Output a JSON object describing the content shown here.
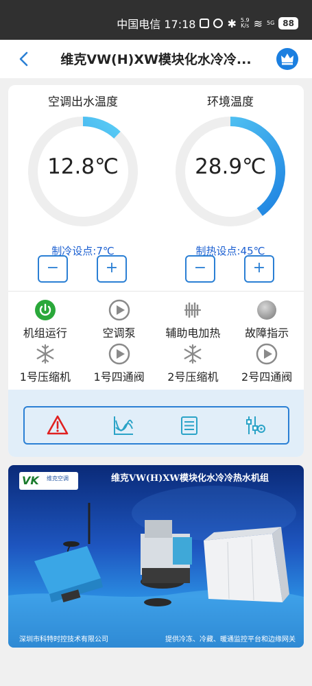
{
  "status_bar": {
    "carrier_time": "中国电信 17:18",
    "speed_value": "5.9",
    "speed_unit": "K/s",
    "signal_label": "5G",
    "battery": "88"
  },
  "header": {
    "title": "维克VW(H)XW模块化水冷冷..."
  },
  "gauges": [
    {
      "title": "空调出水温度",
      "value": "12.8℃",
      "setpoint": "制冷设点:7℃",
      "ring_fraction": 0.12
    },
    {
      "title": "环境温度",
      "value": "28.9℃",
      "setpoint": "制热设点:45℃",
      "ring_fraction": 0.4
    }
  ],
  "buttons": {
    "minus": "−",
    "plus": "+"
  },
  "status_items_row1": [
    {
      "label": "机组运行",
      "icon": "power-icon"
    },
    {
      "label": "空调泵",
      "icon": "pump-play-icon"
    },
    {
      "label": "辅助电加热",
      "icon": "heater-icon"
    },
    {
      "label": "故障指示",
      "icon": "fault-indicator-icon"
    }
  ],
  "status_items_row2": [
    {
      "label": "1号压缩机",
      "icon": "snowflake-icon"
    },
    {
      "label": "1号四通阀",
      "icon": "valve-play-icon"
    },
    {
      "label": "2号压缩机",
      "icon": "snowflake-icon"
    },
    {
      "label": "2号四通阀",
      "icon": "valve-play-icon"
    }
  ],
  "toolbar": [
    "alarm-icon",
    "chart-icon",
    "list-icon",
    "settings-sliders-icon"
  ],
  "banner": {
    "logo_mark": "VK",
    "logo_brand": "维克空调",
    "title": "维克VW(H)XW模块化水冷冷热水机组",
    "footer_left": "深圳市科特时控技术有限公司",
    "footer_right": "提供冷冻、冷藏、暖通监控平台和边缘网关"
  },
  "colors": {
    "accent": "#2a7fd4",
    "setpoint_text": "#1b5fd1",
    "running_green": "#2aa83a",
    "alarm_red": "#e02020",
    "toolbar_bg": "#e1eef9"
  }
}
